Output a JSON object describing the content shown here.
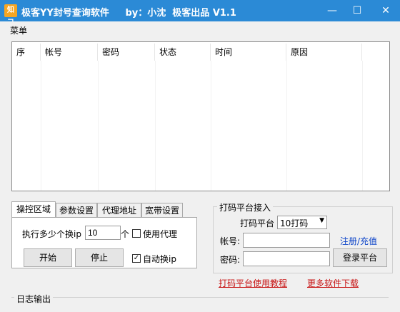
{
  "window": {
    "icon_text": "知己",
    "title": "极客YY封号查询软件     by：小沈  极客出品 V1.1",
    "min": "—",
    "max": "☐",
    "close": "✕"
  },
  "menu": {
    "item": "菜单"
  },
  "grid": {
    "columns": [
      "序",
      "帐号",
      "密码",
      "状态",
      "时间",
      "原因"
    ]
  },
  "tabs": [
    "操控区域",
    "参数设置",
    "代理地址",
    "宽带设置"
  ],
  "control": {
    "ip_label": "执行多少个换ip",
    "ip_value": "10",
    "unit": "个",
    "proxy_label": "使用代理",
    "start": "开始",
    "stop": "停止",
    "auto_ip_label": "自动换ip",
    "auto_ip_checked": "✓"
  },
  "captcha": {
    "group_title": "打码平台接入",
    "platform_label": "打码平台",
    "platform_value": "10打码",
    "account_label": "帐号:",
    "password_label": "密码:",
    "register": "注册/充值",
    "login": "登录平台",
    "tutorial": "打码平台使用教程",
    "more": "更多软件下载"
  },
  "log": {
    "title": "日志输出"
  }
}
